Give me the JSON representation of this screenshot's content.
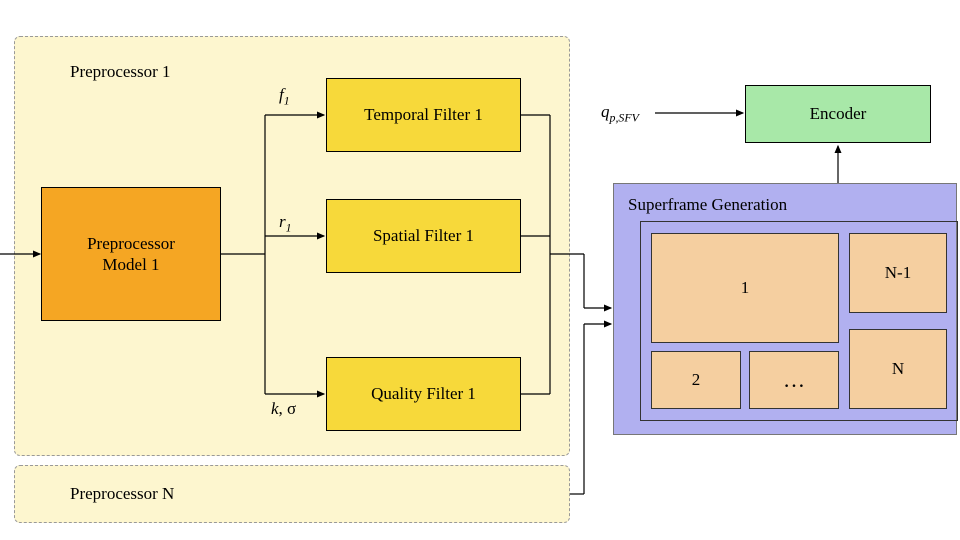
{
  "preproc1_title": "Preprocessor 1",
  "preprocN_title": "Preprocessor N",
  "model_box": "Preprocessor\nModel 1",
  "temporal": "Temporal Filter 1",
  "spatial": "Spatial Filter 1",
  "quality": "Quality Filter 1",
  "f1_html": "<span class=\"ital\">f</span><span class=\"sub\">1</span>",
  "r1_html": "<span class=\"ital\">r</span><span class=\"sub\">1</span>",
  "ksigma_html": "<span class=\"ital\">k</span>, &sigma;",
  "encoder": "Encoder",
  "qpsfv_html": "<span class=\"ital\">q</span><span class=\"sub\">p,SFV</span>",
  "superframe_title": "Superframe Generation",
  "sf_1": "1",
  "sf_2": "2",
  "sf_dots": "…",
  "sf_nm1": "N-1",
  "sf_n": "N"
}
